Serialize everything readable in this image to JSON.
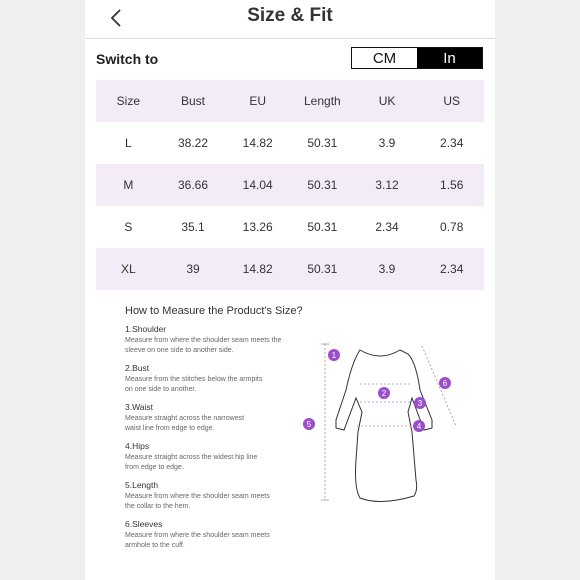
{
  "header": {
    "title": "Size & Fit"
  },
  "switch": {
    "label": "Switch to",
    "cm": "CM",
    "in": "In"
  },
  "table": {
    "headers": [
      "Size",
      "Bust",
      "EU",
      "Length",
      "UK",
      "US"
    ],
    "rows": [
      [
        "L",
        "38.22",
        "14.82",
        "50.31",
        "3.9",
        "2.34"
      ],
      [
        "M",
        "36.66",
        "14.04",
        "50.31",
        "3.12",
        "1.56"
      ],
      [
        "S",
        "35.1",
        "13.26",
        "50.31",
        "2.34",
        "0.78"
      ],
      [
        "XL",
        "39",
        "14.82",
        "50.31",
        "3.9",
        "2.34"
      ]
    ]
  },
  "guide": {
    "title": "How to Measure the Product's Size?",
    "steps": [
      {
        "title": "1.Shoulder",
        "desc1": "Measure from where the shoulder seam meets the",
        "desc2": "sleeve on one side to another side."
      },
      {
        "title": "2.Bust",
        "desc1": "Measure from the stitches below the armpits",
        "desc2": "on one side to another."
      },
      {
        "title": "3.Waist",
        "desc1": "Measure straight across the narrowest",
        "desc2": "waist line from edge to edge."
      },
      {
        "title": "4.Hips",
        "desc1": "Measure straight across the widest hip line",
        "desc2": "from edge to edge."
      },
      {
        "title": "5.Length",
        "desc1": "Measure from where the shoulder seam meets",
        "desc2": "the collar to the hem."
      },
      {
        "title": "6.Sleeves",
        "desc1": "Measure from where the shoulder seam meets",
        "desc2": "armhole to the cuff."
      }
    ],
    "markers": [
      "1",
      "2",
      "3",
      "4",
      "5",
      "6"
    ]
  },
  "colors": {
    "marker": "#9b4dcc",
    "row_shade": "#f3ecf8",
    "toggle_active": "#000000"
  },
  "icons": {
    "back": "chevron-left-icon"
  }
}
